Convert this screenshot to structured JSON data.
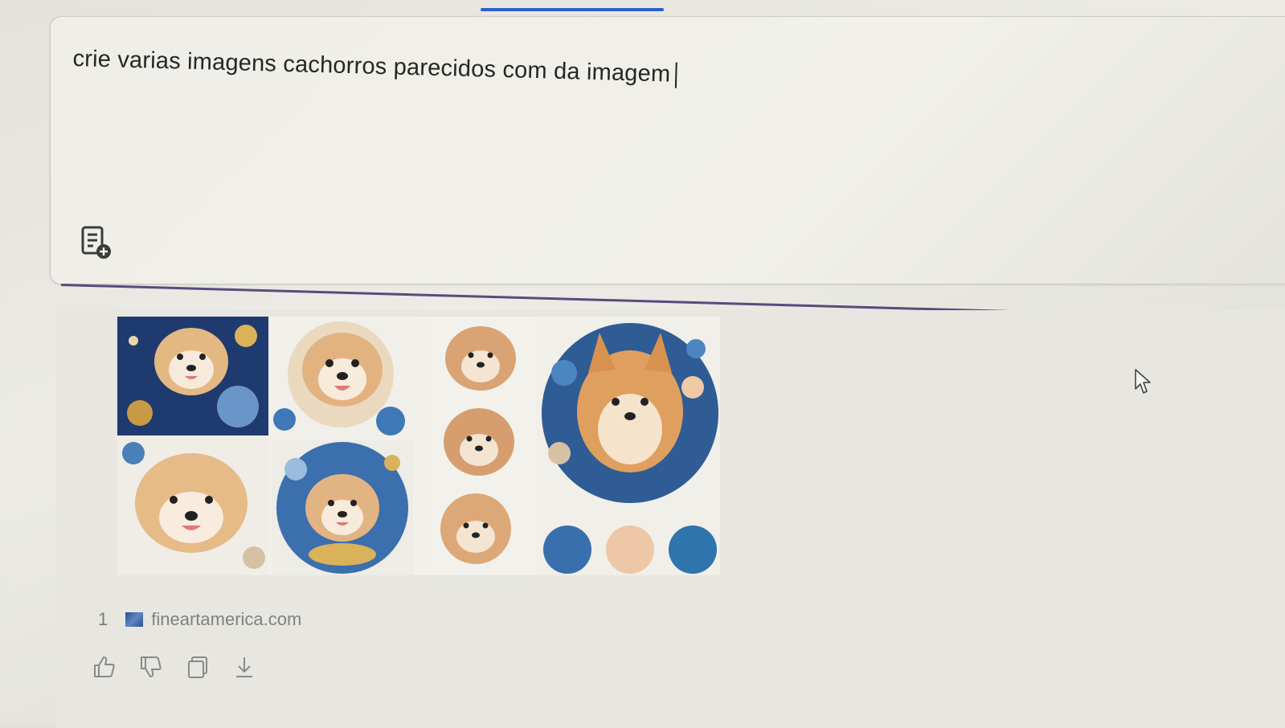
{
  "prompt": {
    "text": "crie varias imagens cachorros parecidos com da imagem",
    "attach_icon": "document-add-icon"
  },
  "response": {
    "image_alt": "grid of puppy portraits with planets",
    "source": {
      "index": "1",
      "domain": "fineartamerica.com",
      "favicon": "image-icon"
    },
    "actions": [
      "thumbs-up-icon",
      "thumbs-down-icon",
      "copy-icon",
      "download-icon"
    ]
  },
  "colors": {
    "accent": "#2f5fc8",
    "divider": "#5a4a7e",
    "text": "#262626",
    "muted": "#7a7a78"
  }
}
